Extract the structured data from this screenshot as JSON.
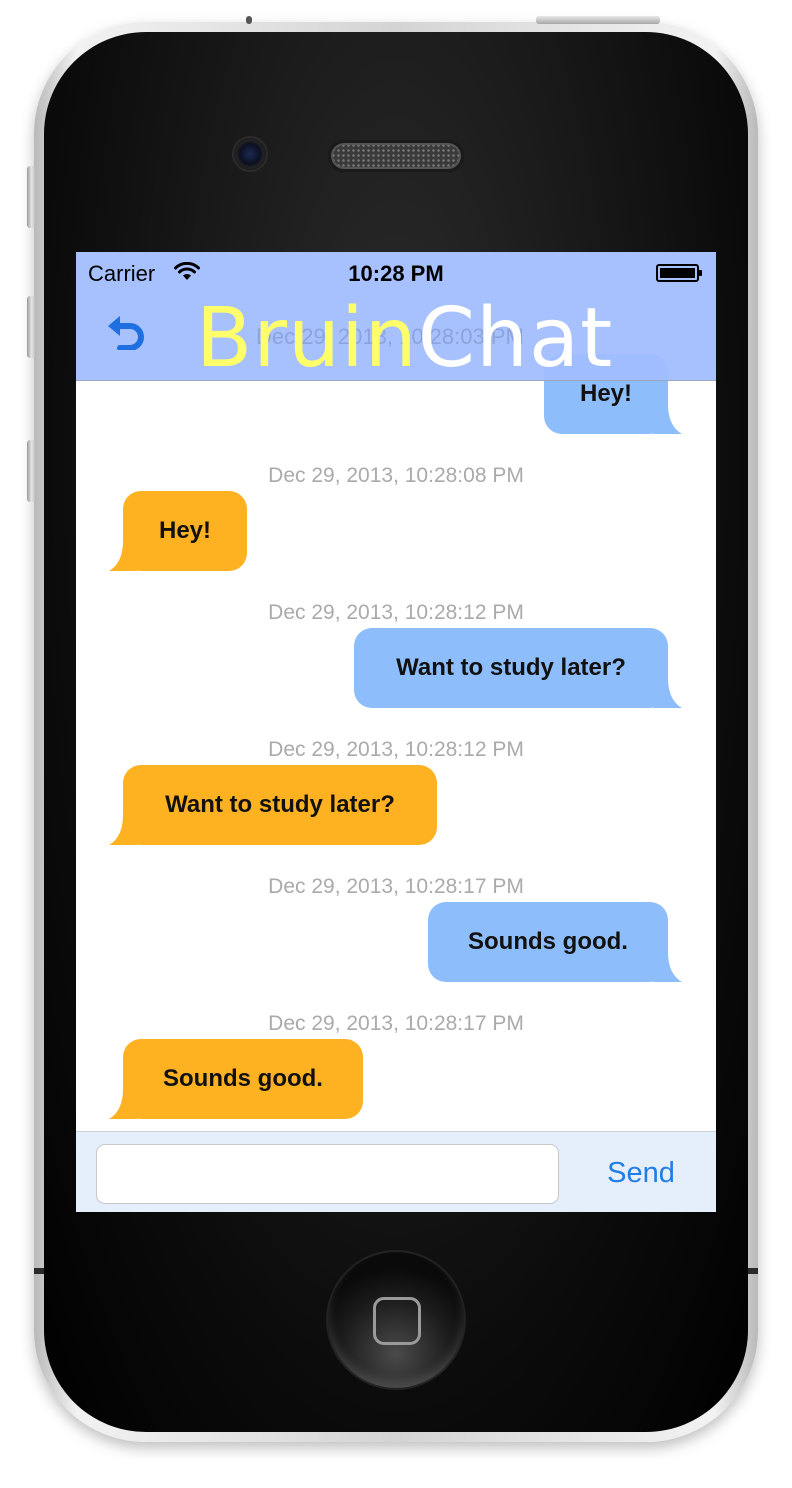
{
  "status_bar": {
    "carrier": "Carrier",
    "time": "10:28 PM",
    "wifi_icon": "wifi-icon",
    "battery_icon": "battery-icon"
  },
  "nav": {
    "logo_part1": "Bruin",
    "logo_part2": "Chat",
    "back_icon": "undo-arrow-icon",
    "ghost_text": "Dec 29, 2013, 10:28:03 PM",
    "colors": {
      "bar": "#a0bcff",
      "logo_part1": "#fffe6b",
      "logo_part2": "#ffffff",
      "back_icon": "#1e6fe0"
    }
  },
  "messages": [
    {
      "direction": "sent",
      "text": "Hey!"
    },
    {
      "timestamp": "Dec 29, 2013, 10:28:08 PM",
      "direction": "received",
      "text": "Hey!"
    },
    {
      "timestamp": "Dec 29, 2013, 10:28:12 PM",
      "direction": "sent",
      "text": "Want to study later?"
    },
    {
      "timestamp": "Dec 29, 2013, 10:28:12 PM",
      "direction": "received",
      "text": "Want to study later?"
    },
    {
      "timestamp": "Dec 29, 2013, 10:28:17 PM",
      "direction": "sent",
      "text": "Sounds good."
    },
    {
      "timestamp": "Dec 29, 2013, 10:28:17 PM",
      "direction": "received",
      "text": "Sounds good."
    }
  ],
  "bubble_colors": {
    "sent": "#8dbdfb",
    "received": "#feb121"
  },
  "input_bar": {
    "message_value": "",
    "message_placeholder": "",
    "send_label": "Send",
    "send_color": "#1e7de6"
  }
}
